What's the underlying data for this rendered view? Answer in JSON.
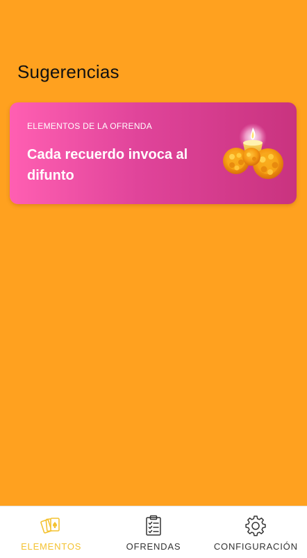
{
  "header": {
    "title": "Sugerencias"
  },
  "card": {
    "eyebrow": "ELEMENTOS DE LA OFRENDA",
    "headline": "Cada recuerdo invoca al difunto",
    "illustration": "candle-marigold-icon"
  },
  "bottom_nav": {
    "items": [
      {
        "label": "ELEMENTOS",
        "icon": "cards-icon",
        "active": true
      },
      {
        "label": "OFRENDAS",
        "icon": "clipboard-list-icon",
        "active": false
      },
      {
        "label": "CONFIGURACIÓN",
        "icon": "gear-icon",
        "active": false
      }
    ]
  },
  "colors": {
    "background": "#FFA11F",
    "card_gradient_start": "#FF5FB2",
    "card_gradient_end": "#C9337F",
    "nav_active": "#F4C231",
    "nav_inactive": "#333333"
  }
}
